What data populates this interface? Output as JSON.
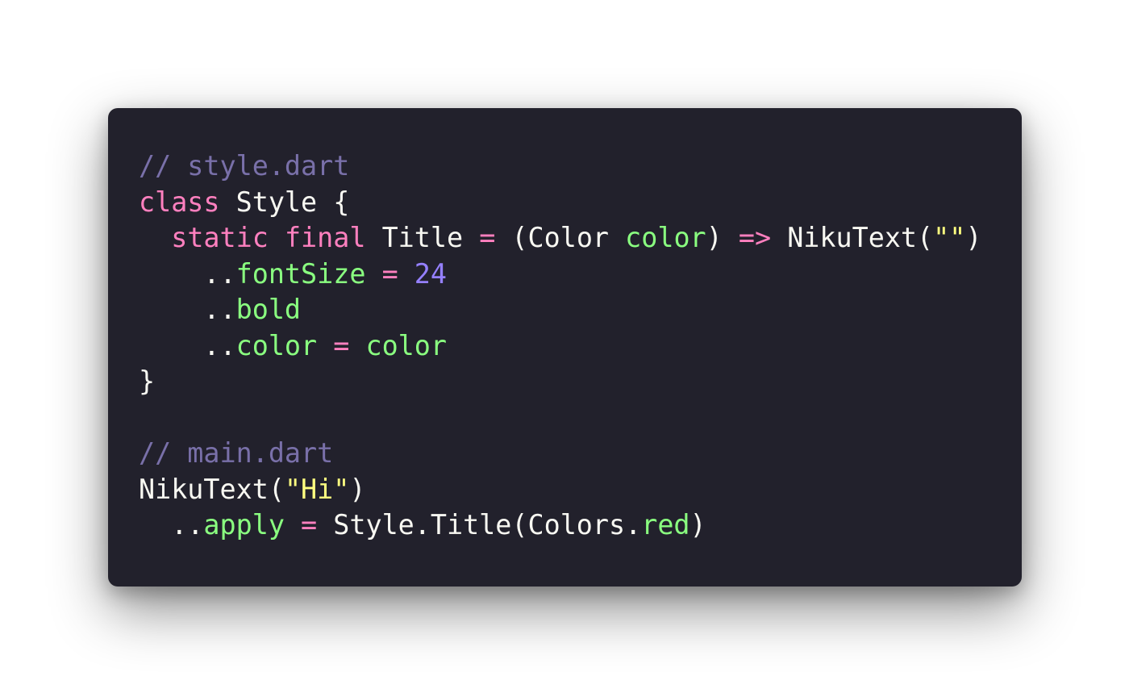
{
  "colors": {
    "background": "#22212c",
    "comment": "#7970a9",
    "keyword": "#ff80bf",
    "plain": "#f8f8f2",
    "field": "#8aff80",
    "number": "#9580ff",
    "string": "#ffff80"
  },
  "code": {
    "lines": [
      [
        {
          "t": "// style.dart",
          "k": "comment"
        }
      ],
      [
        {
          "t": "class",
          "k": "keyword"
        },
        {
          "t": " Style {",
          "k": "plain"
        }
      ],
      [
        {
          "t": "  ",
          "k": "plain"
        },
        {
          "t": "static",
          "k": "keyword"
        },
        {
          "t": " ",
          "k": "plain"
        },
        {
          "t": "final",
          "k": "keyword"
        },
        {
          "t": " Title ",
          "k": "plain"
        },
        {
          "t": "=",
          "k": "keyword"
        },
        {
          "t": " (Color ",
          "k": "plain"
        },
        {
          "t": "color",
          "k": "field"
        },
        {
          "t": ") ",
          "k": "plain"
        },
        {
          "t": "=>",
          "k": "keyword"
        },
        {
          "t": " NikuText(",
          "k": "plain"
        },
        {
          "t": "\"\"",
          "k": "string"
        },
        {
          "t": ")",
          "k": "plain"
        }
      ],
      [
        {
          "t": "    ..",
          "k": "plain"
        },
        {
          "t": "fontSize",
          "k": "field"
        },
        {
          "t": " ",
          "k": "plain"
        },
        {
          "t": "=",
          "k": "keyword"
        },
        {
          "t": " ",
          "k": "plain"
        },
        {
          "t": "24",
          "k": "number"
        }
      ],
      [
        {
          "t": "    ..",
          "k": "plain"
        },
        {
          "t": "bold",
          "k": "field"
        }
      ],
      [
        {
          "t": "    ..",
          "k": "plain"
        },
        {
          "t": "color",
          "k": "field"
        },
        {
          "t": " ",
          "k": "plain"
        },
        {
          "t": "=",
          "k": "keyword"
        },
        {
          "t": " ",
          "k": "plain"
        },
        {
          "t": "color",
          "k": "field"
        }
      ],
      [
        {
          "t": "}",
          "k": "plain"
        }
      ],
      [],
      [
        {
          "t": "// main.dart",
          "k": "comment"
        }
      ],
      [
        {
          "t": "NikuText(",
          "k": "plain"
        },
        {
          "t": "\"Hi\"",
          "k": "string"
        },
        {
          "t": ")",
          "k": "plain"
        }
      ],
      [
        {
          "t": "  ..",
          "k": "plain"
        },
        {
          "t": "apply",
          "k": "field"
        },
        {
          "t": " ",
          "k": "plain"
        },
        {
          "t": "=",
          "k": "keyword"
        },
        {
          "t": " Style.Title(Colors.",
          "k": "plain"
        },
        {
          "t": "red",
          "k": "field"
        },
        {
          "t": ")",
          "k": "plain"
        }
      ]
    ]
  }
}
